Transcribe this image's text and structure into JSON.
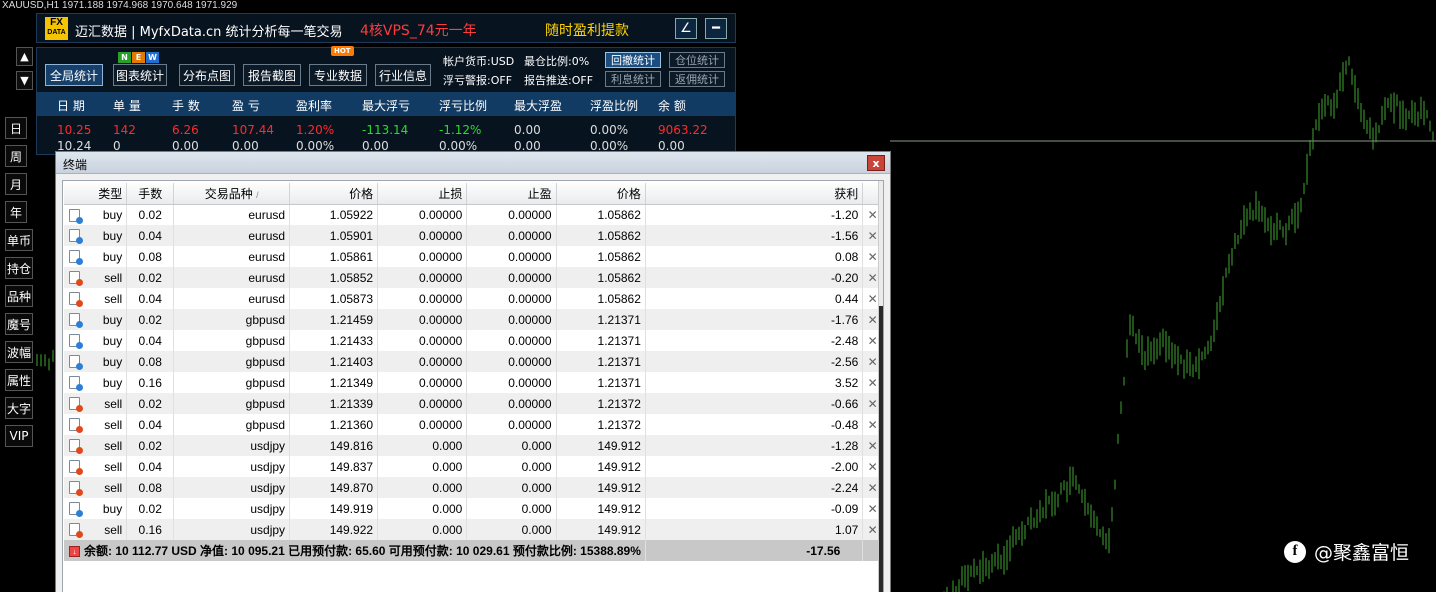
{
  "chart": {
    "header": "XAUUSD,H1  1971.188 1974.968 1970.648 1971.929",
    "candle_color": "#3fa62f",
    "price_line_color": "#8a9a8a"
  },
  "watermark": {
    "logo": "f",
    "text": "@聚鑫富恒"
  },
  "side_panel": {
    "up_arrow": "▲",
    "down_arrow": "▼",
    "buttons": [
      "日",
      "周",
      "月",
      "年",
      "单币",
      "持仓",
      "品种",
      "魔号",
      "波幅",
      "属性",
      "大字",
      "VIP"
    ]
  },
  "top_bar": {
    "logo_top": "FX",
    "logo_bottom": "DATA",
    "title": "迈汇数据 | MyfxData.cn  统计分析每一笔交易",
    "vps_link": "4核VPS_74元一年",
    "promo_link": "随时盈利提款",
    "edit_icon": "∠",
    "minimize_icon": "━"
  },
  "stats": {
    "tabs": [
      "全局统计",
      "图表统计",
      "分布点图",
      "报告截图",
      "专业数据",
      "行业信息"
    ],
    "new_badge": [
      "N",
      "E",
      "W"
    ],
    "hot_badge": "HOT",
    "account_currency": "帐户货币:USD",
    "max_position_ratio": "最仓比例:0%",
    "float_loss_alert": "浮亏警报:OFF",
    "report_push": "报告推送:OFF",
    "mini_buttons": [
      "回撤统计",
      "仓位统计",
      "利息统计",
      "返佣统计"
    ],
    "headers": [
      "日 期",
      "单 量",
      "手 数",
      "盈 亏",
      "盈利率",
      "最大浮亏",
      "浮亏比例",
      "最大浮盈",
      "浮盈比例",
      "余 额"
    ],
    "rows": [
      [
        "10.25",
        "142",
        "6.26",
        "107.44",
        "1.20%",
        "-113.14",
        "-1.12%",
        "0.00",
        "0.00%",
        "9063.22"
      ],
      [
        "10.24",
        "0",
        "0.00",
        "0.00",
        "0.00%",
        "0.00",
        "0.00%",
        "0.00",
        "0.00%",
        "0.00"
      ]
    ]
  },
  "terminal": {
    "title": "终端",
    "close_icon": "x",
    "columns": [
      "类型",
      "手数",
      "交易品种",
      "价格",
      "止损",
      "止盈",
      "价格",
      "获利"
    ],
    "sort_indicator": "/",
    "orders": [
      {
        "type": "buy",
        "lots": "0.02",
        "symbol": "eurusd",
        "open": "1.05922",
        "sl": "0.00000",
        "tp": "0.00000",
        "price": "1.05862",
        "profit": "-1.20"
      },
      {
        "type": "buy",
        "lots": "0.04",
        "symbol": "eurusd",
        "open": "1.05901",
        "sl": "0.00000",
        "tp": "0.00000",
        "price": "1.05862",
        "profit": "-1.56"
      },
      {
        "type": "buy",
        "lots": "0.08",
        "symbol": "eurusd",
        "open": "1.05861",
        "sl": "0.00000",
        "tp": "0.00000",
        "price": "1.05862",
        "profit": "0.08"
      },
      {
        "type": "sell",
        "lots": "0.02",
        "symbol": "eurusd",
        "open": "1.05852",
        "sl": "0.00000",
        "tp": "0.00000",
        "price": "1.05862",
        "profit": "-0.20"
      },
      {
        "type": "sell",
        "lots": "0.04",
        "symbol": "eurusd",
        "open": "1.05873",
        "sl": "0.00000",
        "tp": "0.00000",
        "price": "1.05862",
        "profit": "0.44"
      },
      {
        "type": "buy",
        "lots": "0.02",
        "symbol": "gbpusd",
        "open": "1.21459",
        "sl": "0.00000",
        "tp": "0.00000",
        "price": "1.21371",
        "profit": "-1.76"
      },
      {
        "type": "buy",
        "lots": "0.04",
        "symbol": "gbpusd",
        "open": "1.21433",
        "sl": "0.00000",
        "tp": "0.00000",
        "price": "1.21371",
        "profit": "-2.48"
      },
      {
        "type": "buy",
        "lots": "0.08",
        "symbol": "gbpusd",
        "open": "1.21403",
        "sl": "0.00000",
        "tp": "0.00000",
        "price": "1.21371",
        "profit": "-2.56"
      },
      {
        "type": "buy",
        "lots": "0.16",
        "symbol": "gbpusd",
        "open": "1.21349",
        "sl": "0.00000",
        "tp": "0.00000",
        "price": "1.21371",
        "profit": "3.52"
      },
      {
        "type": "sell",
        "lots": "0.02",
        "symbol": "gbpusd",
        "open": "1.21339",
        "sl": "0.00000",
        "tp": "0.00000",
        "price": "1.21372",
        "profit": "-0.66"
      },
      {
        "type": "sell",
        "lots": "0.04",
        "symbol": "gbpusd",
        "open": "1.21360",
        "sl": "0.00000",
        "tp": "0.00000",
        "price": "1.21372",
        "profit": "-0.48"
      },
      {
        "type": "sell",
        "lots": "0.02",
        "symbol": "usdjpy",
        "open": "149.816",
        "sl": "0.000",
        "tp": "0.000",
        "price": "149.912",
        "profit": "-1.28"
      },
      {
        "type": "sell",
        "lots": "0.04",
        "symbol": "usdjpy",
        "open": "149.837",
        "sl": "0.000",
        "tp": "0.000",
        "price": "149.912",
        "profit": "-2.00"
      },
      {
        "type": "sell",
        "lots": "0.08",
        "symbol": "usdjpy",
        "open": "149.870",
        "sl": "0.000",
        "tp": "0.000",
        "price": "149.912",
        "profit": "-2.24"
      },
      {
        "type": "buy",
        "lots": "0.02",
        "symbol": "usdjpy",
        "open": "149.919",
        "sl": "0.000",
        "tp": "0.000",
        "price": "149.912",
        "profit": "-0.09"
      },
      {
        "type": "sell",
        "lots": "0.16",
        "symbol": "usdjpy",
        "open": "149.922",
        "sl": "0.000",
        "tp": "0.000",
        "price": "149.912",
        "profit": "1.07"
      }
    ],
    "row_close_icon": "✕",
    "summary": {
      "text": "余额: 10 112.77 USD  净值: 10 095.21  已用预付款: 65.60  可用预付款: 10 029.61  预付款比例: 15388.89%",
      "total_profit": "-17.56"
    }
  }
}
